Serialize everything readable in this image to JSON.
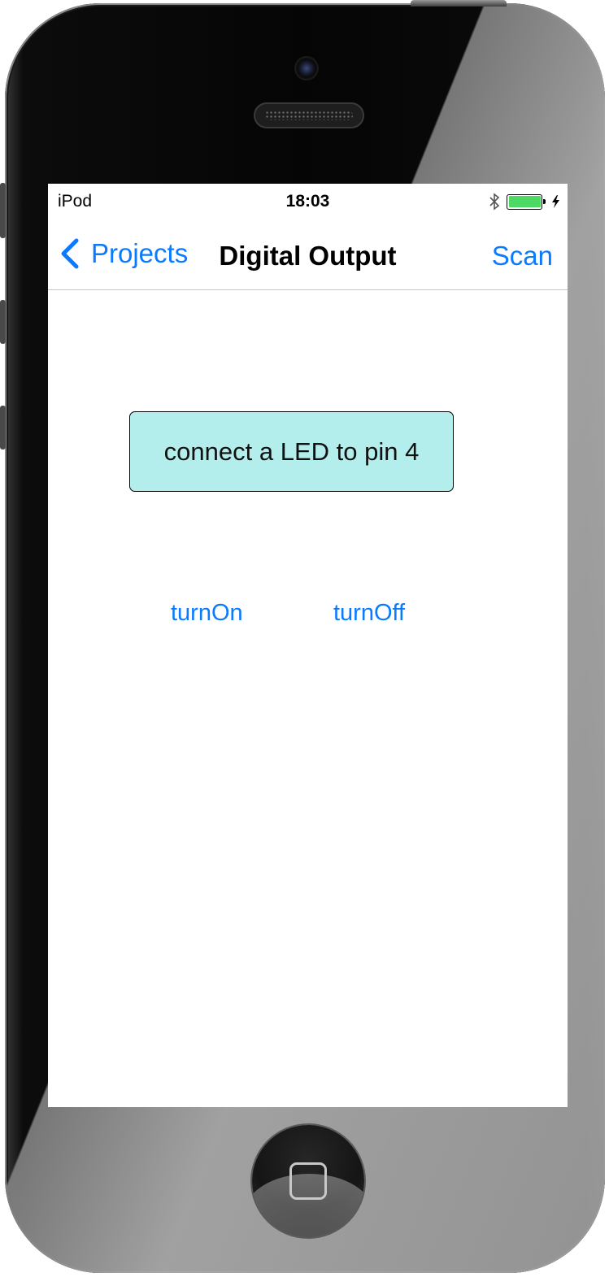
{
  "status_bar": {
    "carrier": "iPod",
    "time": "18:03",
    "battery_level": 1.0,
    "battery_color": "#4cd964",
    "icons": [
      "bluetooth-icon",
      "battery-icon",
      "charging-bolt-icon"
    ]
  },
  "nav_bar": {
    "back_label": "Projects",
    "title": "Digital Output",
    "right_label": "Scan",
    "accent_color": "#0a7aff"
  },
  "main": {
    "info_text": "connect a LED to pin 4",
    "info_background": "#b4eeec",
    "buttons": [
      {
        "label": "turnOn"
      },
      {
        "label": "turnOff"
      }
    ]
  }
}
